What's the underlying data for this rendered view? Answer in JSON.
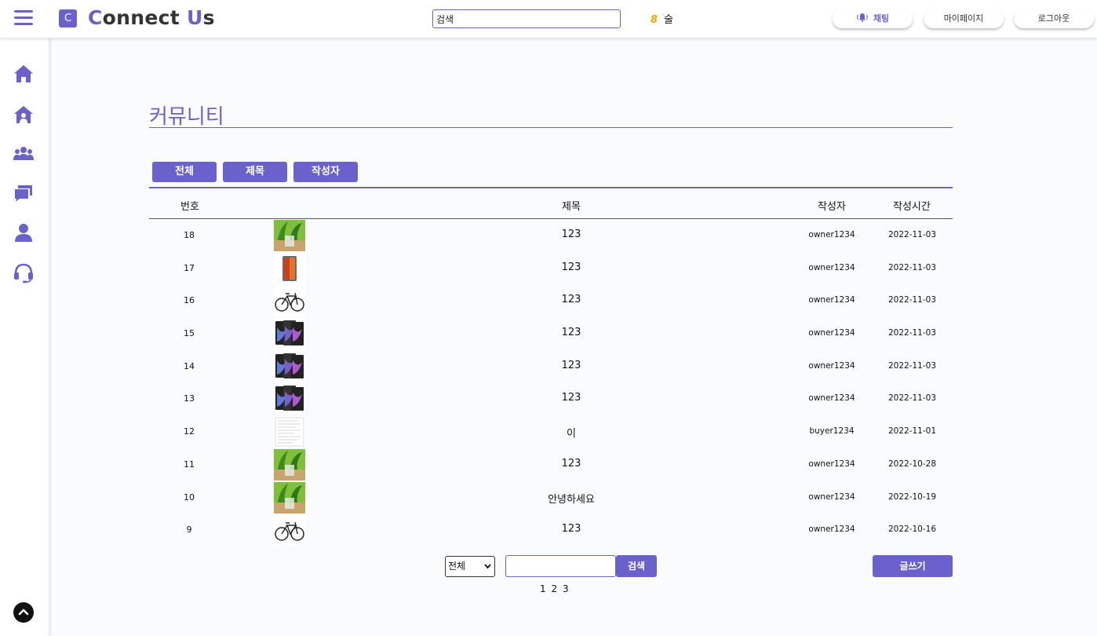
{
  "header": {
    "logo_letter": "C",
    "logo_c": "C",
    "logo_mid": "onnect ",
    "logo_u": "U",
    "logo_end": "s",
    "search_value": "검색",
    "weather_num": "8",
    "weather_text": "술",
    "chat_label": "채팅",
    "mypage_label": "마이페이지",
    "logout_label": "로그아웃"
  },
  "colors": {
    "accent": "#6a61cc",
    "weather": "#f2a800"
  },
  "sidebar": {
    "icons": [
      "home-icon",
      "store-icon",
      "users-icon",
      "chat-icon",
      "user-icon",
      "headset-icon"
    ],
    "scroll_top_icon": "chevron-up-icon"
  },
  "page": {
    "title": "커뮤니티"
  },
  "filters": [
    "전체",
    "제목",
    "작성자"
  ],
  "table": {
    "headers": {
      "num": "번호",
      "title": "제목",
      "author": "작성자",
      "date": "작성시간"
    },
    "rows": [
      {
        "num": "18",
        "thumb": "plant",
        "title": "123",
        "author": "owner1234",
        "date": "2022-11-03"
      },
      {
        "num": "17",
        "thumb": "tablet",
        "title": "123",
        "author": "owner1234",
        "date": "2022-11-03"
      },
      {
        "num": "16",
        "thumb": "bicycle",
        "title": "123",
        "author": "owner1234",
        "date": "2022-11-03"
      },
      {
        "num": "15",
        "thumb": "ipads",
        "title": "123",
        "author": "owner1234",
        "date": "2022-11-03"
      },
      {
        "num": "14",
        "thumb": "ipads",
        "title": "123",
        "author": "owner1234",
        "date": "2022-11-03"
      },
      {
        "num": "13",
        "thumb": "ipads",
        "title": "123",
        "author": "owner1234",
        "date": "2022-11-03"
      },
      {
        "num": "12",
        "thumb": "document",
        "title": "이",
        "author": "buyer1234",
        "date": "2022-11-01"
      },
      {
        "num": "11",
        "thumb": "plant",
        "title": "123",
        "author": "owner1234",
        "date": "2022-10-28"
      },
      {
        "num": "10",
        "thumb": "plant",
        "title": "안녕하세요",
        "author": "owner1234",
        "date": "2022-10-19"
      },
      {
        "num": "9",
        "thumb": "bicycle",
        "title": "123",
        "author": "owner1234",
        "date": "2022-10-16"
      }
    ]
  },
  "bottom": {
    "select_value": "전체",
    "search_button": "검색",
    "write_button": "글쓰기",
    "pages": [
      "1",
      "2",
      "3"
    ]
  }
}
